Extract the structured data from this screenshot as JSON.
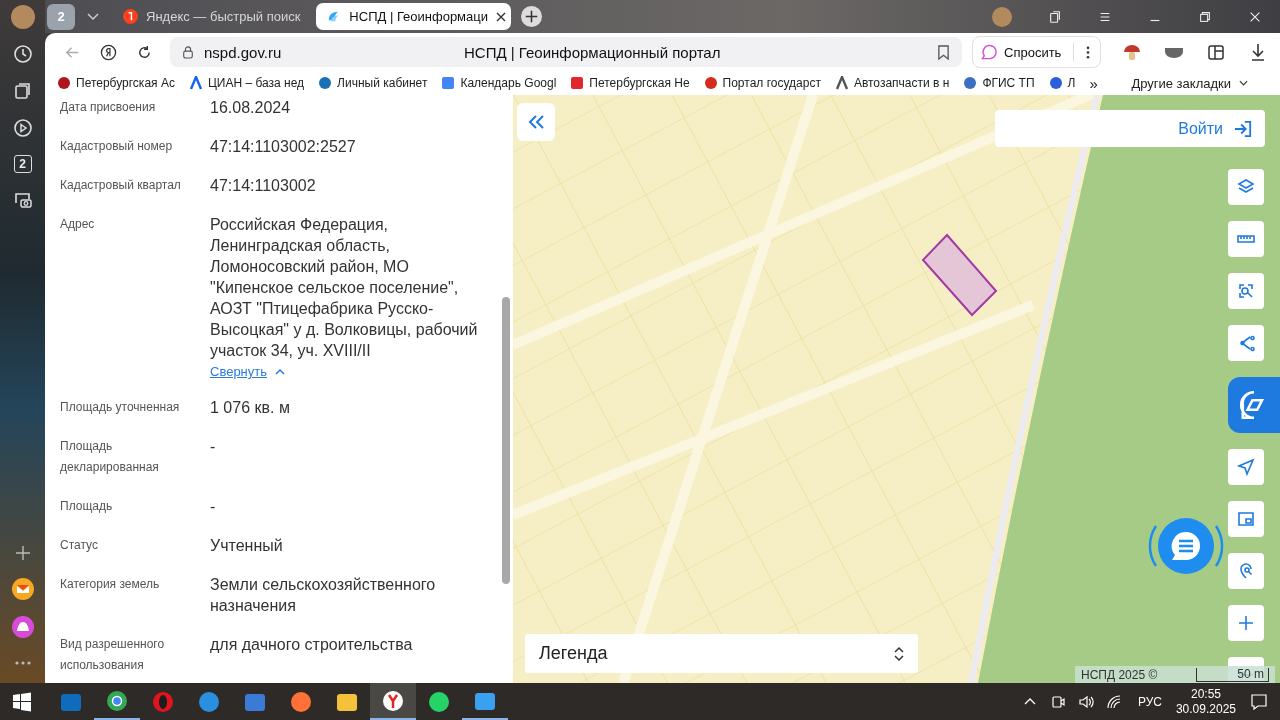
{
  "rail": {
    "top": [
      {
        "kind": "history"
      },
      {
        "kind": "collections"
      },
      {
        "kind": "video"
      },
      {
        "kind": "tabs",
        "label": "2"
      },
      {
        "kind": "screenshot"
      }
    ],
    "bottom": [
      {
        "kind": "add"
      },
      {
        "kind": "mail"
      },
      {
        "kind": "alice"
      },
      {
        "kind": "more"
      }
    ]
  },
  "tab_strip": {
    "tab_count": "2",
    "tabs": [
      {
        "kind": "yandex",
        "title": "Яндекс — быстрый поиск",
        "selected": false
      },
      {
        "kind": "nspd",
        "title": "НСПД | Геоинформаци",
        "selected": true
      }
    ]
  },
  "toolbar": {
    "url": "nspd.gov.ru",
    "page_title": "НСПД | Геоинформационный портал",
    "ask_button": "Спросить"
  },
  "bookmarks": {
    "items": [
      {
        "kind": "red-circle",
        "label": "Петербургская Ас"
      },
      {
        "kind": "cian",
        "label": "ЦИАН – база нед"
      },
      {
        "kind": "globe",
        "label": "Личный кабинет"
      },
      {
        "kind": "calendar",
        "label": "Календарь Googl"
      },
      {
        "kind": "red-square",
        "label": "Петербургская Не"
      },
      {
        "kind": "flag",
        "label": "Портал государст"
      },
      {
        "kind": "wrench",
        "label": "Автозапчасти в н"
      },
      {
        "kind": "emblem",
        "label": "ФГИС ТП"
      },
      {
        "kind": "chat",
        "label": "Л"
      }
    ],
    "more": "»",
    "other": "Другие закладки"
  },
  "panel": {
    "rows": [
      {
        "label": "Дата присвоения",
        "value": "16.08.2024"
      },
      {
        "label": "Кадастровый номер",
        "value": "47:14:1103002:2527"
      },
      {
        "label": "Кадастровый квартал",
        "value": "47:14:1103002"
      },
      {
        "label": "Адрес",
        "value": "Российская Федерация, Ленинградская область, Ломоносовский район, МО \"Кипенское сельское поселение\", АОЗТ \"Птицефабрика Русско-Высоцкая\" у д. Волковицы, рабочий участок 34, уч. XVIII/II",
        "link": "Свернуть"
      },
      {
        "label": "Площадь уточненная",
        "value": "1 076 кв. м"
      },
      {
        "label": "Площадь декларированная",
        "value": "-"
      },
      {
        "label": "Площадь",
        "value": "-"
      },
      {
        "label": "Статус",
        "value": "Учтенный"
      },
      {
        "label": "Категория земель",
        "value": "Земли сельскохозяйственного назначения"
      },
      {
        "label": "Вид разрешенного использования",
        "value": "для дачного строительства"
      }
    ]
  },
  "map": {
    "login": "Войти",
    "legend": "Легенда",
    "attribution": "НСПД 2025 ©",
    "scale": "50 m",
    "tools": [
      {
        "kind": "layers",
        "selected": false
      },
      {
        "kind": "ruler",
        "selected": false
      },
      {
        "kind": "select",
        "selected": false
      },
      {
        "kind": "share",
        "selected": false
      },
      {
        "kind": "portal",
        "selected": true
      },
      {
        "kind": "locate",
        "selected": false
      },
      {
        "kind": "minimap",
        "selected": false
      },
      {
        "kind": "geosearch",
        "selected": false
      },
      {
        "kind": "zoom-in",
        "selected": false
      },
      {
        "kind": "zoom-out",
        "selected": false
      }
    ]
  },
  "taskbar": {
    "apps": [
      {
        "kind": "outlook",
        "running": false,
        "active": false
      },
      {
        "kind": "chrome",
        "running": true,
        "active": false
      },
      {
        "kind": "opera",
        "running": false,
        "active": false
      },
      {
        "kind": "web",
        "running": false,
        "active": false
      },
      {
        "kind": "store",
        "running": false,
        "active": false
      },
      {
        "kind": "firefox",
        "running": false,
        "active": false
      },
      {
        "kind": "explorer",
        "running": false,
        "active": false
      },
      {
        "kind": "yandex",
        "running": true,
        "active": true
      },
      {
        "kind": "whatsapp",
        "running": false,
        "active": false
      },
      {
        "kind": "photos",
        "running": true,
        "active": false
      }
    ],
    "language": "РУС",
    "time": "20:55",
    "date": "30.09.2025"
  }
}
